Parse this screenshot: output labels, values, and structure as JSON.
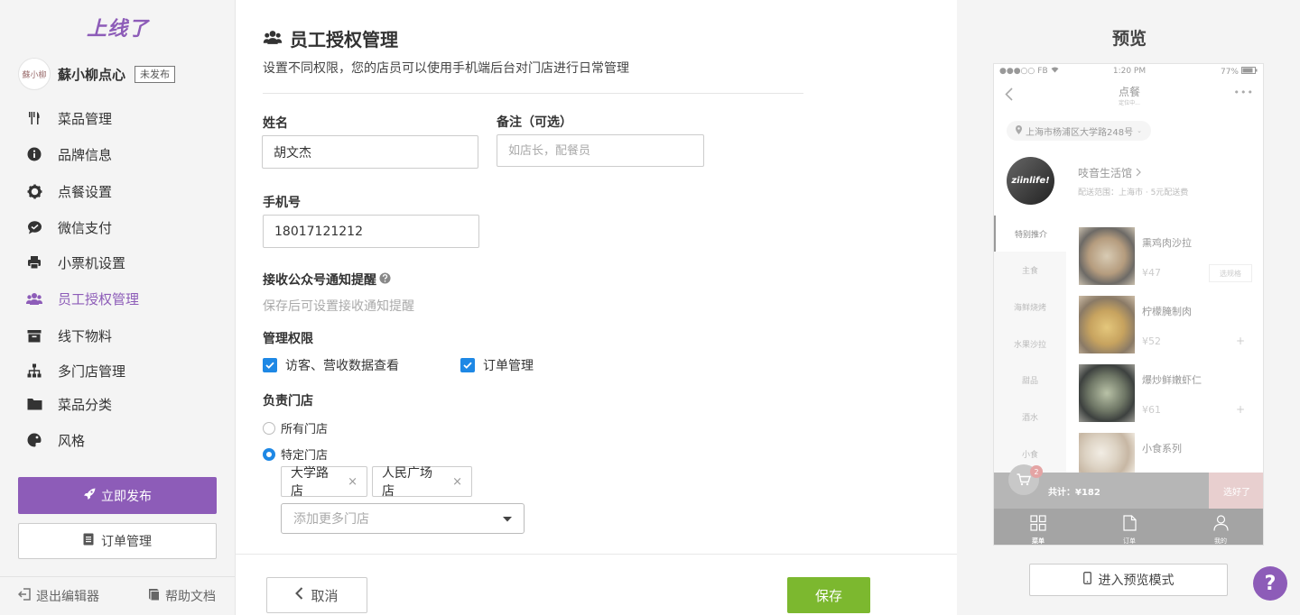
{
  "brand": {
    "logo_text": "上线了",
    "accent": "#8d5cb8"
  },
  "shop": {
    "name": "蘇小柳点心",
    "status_badge": "未发布",
    "avatar_text": "蘇小柳"
  },
  "sidebar": {
    "items": [
      {
        "label": "菜品管理",
        "icon": "fork-knife-icon"
      },
      {
        "label": "品牌信息",
        "icon": "info-icon"
      },
      {
        "label": "点餐设置",
        "icon": "gear-icon"
      },
      {
        "label": "微信支付",
        "icon": "wechat-icon"
      },
      {
        "label": "小票机设置",
        "icon": "printer-icon"
      },
      {
        "label": "员工授权管理",
        "icon": "users-icon",
        "active": true
      },
      {
        "label": "线下物料",
        "icon": "archive-icon"
      },
      {
        "label": "多门店管理",
        "icon": "sitemap-icon"
      },
      {
        "label": "菜品分类",
        "icon": "folder-icon"
      },
      {
        "label": "风格",
        "icon": "palette-icon"
      }
    ],
    "publish_button": "立即发布",
    "orders_button": "订单管理",
    "exit_editor": "退出编辑器",
    "help_docs": "帮助文档"
  },
  "form": {
    "title": "员工授权管理",
    "description": "设置不同权限，您的店员可以使用手机端后台对门店进行日常管理",
    "name_label": "姓名",
    "name_value": "胡文杰",
    "note_label": "备注（可选）",
    "note_placeholder": "如店长，配餐员",
    "phone_label": "手机号",
    "phone_value": "18017121212",
    "notify_label": "接收公众号通知提醒",
    "notify_hint": "保存后可设置接收通知提醒",
    "perm_label": "管理权限",
    "perm_options": [
      {
        "label": "访客、营收数据查看",
        "checked": true
      },
      {
        "label": "订单管理",
        "checked": true
      }
    ],
    "store_label": "负责门店",
    "store_options": [
      {
        "label": "所有门店",
        "selected": false
      },
      {
        "label": "特定门店",
        "selected": true
      }
    ],
    "selected_stores": [
      "大学路店",
      "人民广场店"
    ],
    "store_select_placeholder": "添加更多门店",
    "cancel_button": "取消",
    "save_button": "保存",
    "save_color": "#7cb82f"
  },
  "preview": {
    "title": "预览",
    "status_carrier": "FB",
    "status_time": "1:20 PM",
    "status_battery": "77%",
    "nav_title": "点餐",
    "nav_subtitle": "定位中...",
    "location": "上海市杨浦区大学路248号",
    "shop_logo_text": "ziinlife!",
    "shop_name": "吱音生活馆",
    "delivery_info": "配送范围：上海市 · 5元配送费",
    "categories": [
      "特别推介",
      "主食",
      "海鲜烧烤",
      "水果沙拉",
      "甜品",
      "酒水",
      "小食"
    ],
    "dishes": [
      {
        "name": "熏鸡肉沙拉",
        "price": "¥47",
        "action": "选规格"
      },
      {
        "name": "柠檬腌制肉",
        "price": "¥52",
        "action": "+"
      },
      {
        "name": "爆炒鲜嫩虾仁",
        "price": "¥61",
        "action": "+"
      },
      {
        "name": "小食系列",
        "price": "",
        "action": ""
      }
    ],
    "cart_count": "2",
    "cart_total": "共计：¥182",
    "checkout_button": "选好了",
    "tabs": [
      {
        "label": "菜单",
        "icon": "grid-icon"
      },
      {
        "label": "订单",
        "icon": "document-icon"
      },
      {
        "label": "我的",
        "icon": "person-icon"
      }
    ],
    "preview_mode_button": "进入预览模式"
  },
  "help": {
    "label": "?"
  }
}
